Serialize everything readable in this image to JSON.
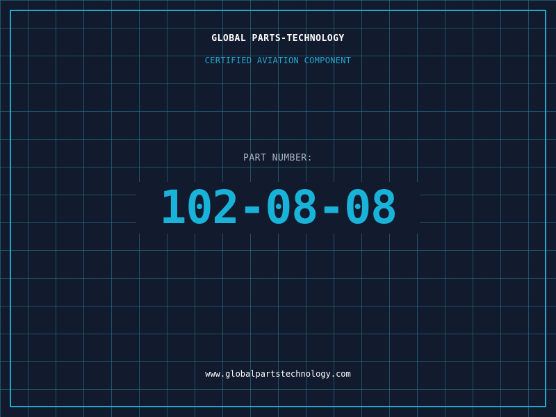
{
  "header": {
    "title": "GLOBAL PARTS-TECHNOLOGY",
    "subtitle": "CERTIFIED AVIATION COMPONENT"
  },
  "part": {
    "label": "PART NUMBER:",
    "number": "102-08-08"
  },
  "footer": {
    "website": "www.globalpartstechnology.com"
  },
  "colors": {
    "background": "#121a2e",
    "grid": "#2b7d96",
    "accent": "#1fa9cf",
    "part_number": "#19b3d9",
    "label": "#a9b7c6",
    "text": "#ffffff"
  }
}
